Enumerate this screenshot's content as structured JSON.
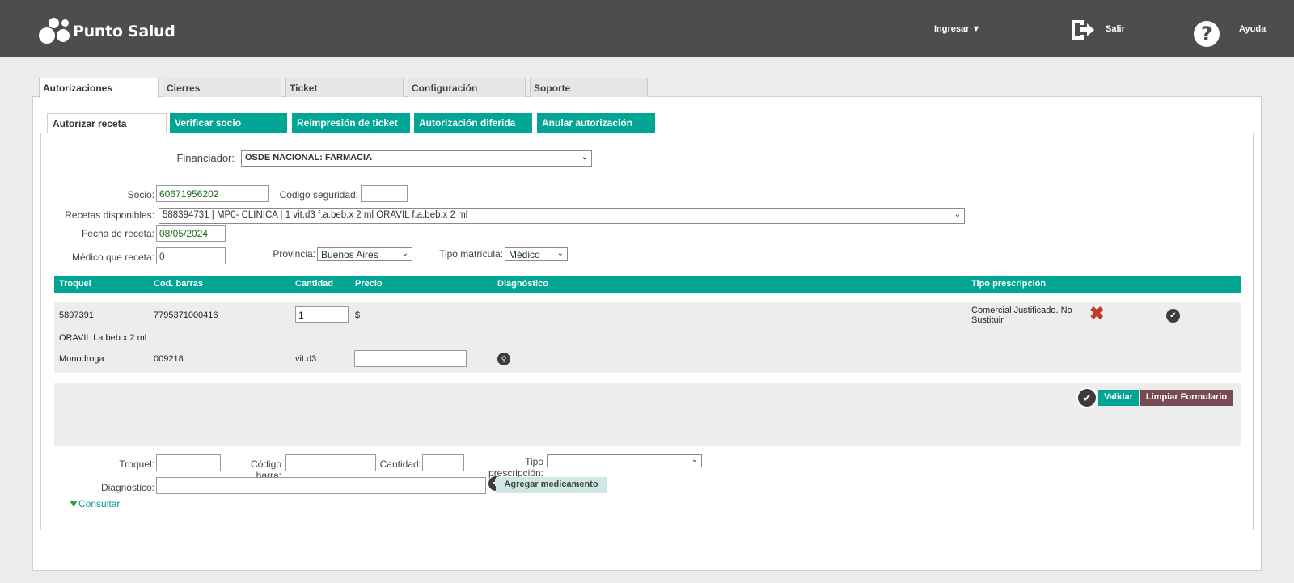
{
  "header": {
    "logo_text": "Punto Salud",
    "ingresar": "Ingresar ▼",
    "salir": "Salir",
    "ayuda": "Ayuda",
    "ayuda_glyph": "?"
  },
  "main_tabs": [
    "Autorizaciones",
    "Cierres",
    "Ticket",
    "Configuración",
    "Soporte"
  ],
  "sub_tabs": [
    "Autorizar receta",
    "Verificar socio",
    "Reimpresión de ticket",
    "Autorización diferida",
    "Anular autorización"
  ],
  "form": {
    "financiador_label": "Financiador:",
    "financiador_value": "OSDE NACIONAL: FARMACIA",
    "socio_label": "Socio:",
    "socio_value": "60671956202",
    "codigo_seguridad_label": "Código seguridad:",
    "codigo_seguridad_value": "",
    "recetas_label": "Recetas disponibles:",
    "recetas_value": "588394731 | MP0- CLINICA | 1 vit.d3 f.a.beb.x 2 ml ORAVIL f.a.beb.x 2 ml",
    "fecha_label": "Fecha de receta:",
    "fecha_value": "08/05/2024",
    "medico_label": "Médico que receta:",
    "medico_value": "0",
    "provincia_label": "Provincia:",
    "provincia_value": "Buenos Aires",
    "tipo_matricula_label": "Tipo matrícula:",
    "tipo_matricula_value": "Médico"
  },
  "table": {
    "headers": [
      "Troquel",
      "Cod. barras",
      "Cantidad",
      "Precio",
      "Diagnóstico",
      "Tipo prescripción"
    ],
    "row": {
      "troquel": "5897391",
      "cod_barras": "7795371000416",
      "cantidad": "1",
      "precio": "$",
      "tipo_prescripcion": "Comercial Justificado. No Sustituir",
      "nombre": "ORAVIL f.a.beb.x 2 ml",
      "monodroga_label": "Monodroga:",
      "monodroga_code": "009218",
      "monodroga_name": "vit.d3",
      "diagnostico_value": ""
    }
  },
  "actions": {
    "validar": "Validar",
    "limpiar": "Limpiar Formulario"
  },
  "add_form": {
    "troquel_label": "Troquel:",
    "codigo_barra_label": "Código barra:",
    "cantidad_label": "Cantidad:",
    "tipo_prescripcion_label": "Tipo prescripción:",
    "diagnostico_label": "Diagnóstico:",
    "agregar": "Agregar medicamento",
    "consultar": "Consultar"
  },
  "colors": {
    "accent": "#00a593",
    "header_bg": "#4d4d4d",
    "danger": "#c0392b",
    "limpiar_bg": "#7a4a54"
  }
}
